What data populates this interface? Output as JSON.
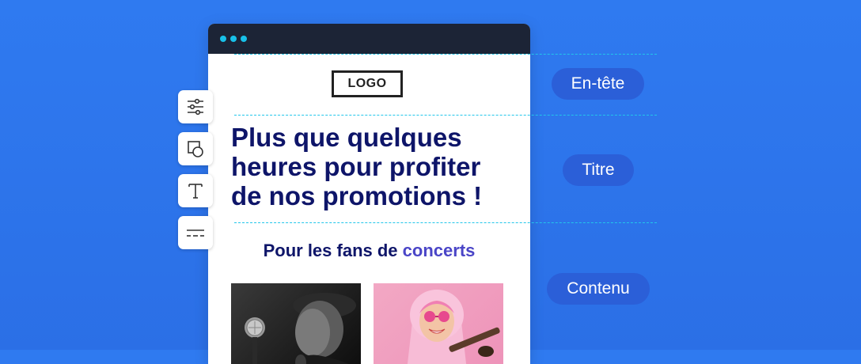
{
  "editor": {
    "logo_text": "LOGO",
    "headline_lines": [
      "Plus que quelques",
      "heures pour profiter",
      "de nos promotions !"
    ],
    "subhead_prefix": "Pour les fans de",
    "subhead_accent": "concerts"
  },
  "section_labels": {
    "header": "En-tête",
    "title": "Titre",
    "content": "Contenu"
  },
  "toolbar": {
    "tools": [
      "sliders-icon",
      "shapes-icon",
      "text-icon",
      "divider-icon"
    ]
  },
  "colors": {
    "background": "#2f7af0",
    "guide_line": "#22c6ea",
    "pill": "#2b5fd8",
    "headline": "#0e1569",
    "accent": "#4a45c7",
    "titlebar": "#1c2436"
  }
}
